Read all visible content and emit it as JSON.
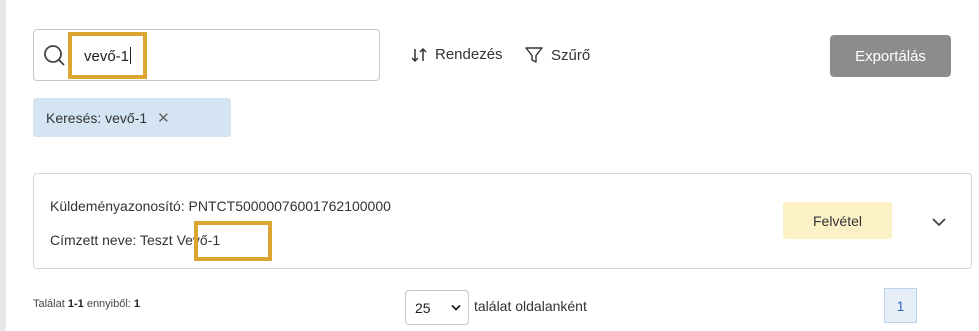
{
  "search": {
    "value": "vevő-1"
  },
  "toolbar": {
    "sort_label": "Rendezés",
    "filter_label": "Szűrő",
    "export_label": "Exportálás"
  },
  "active_filter": {
    "label": "Keresés: vevő-1",
    "close_glyph": "✕"
  },
  "shipment": {
    "id_text": "Küldeményazonosító: PNTCT50000076001762100000",
    "recipient_prefix": "Címzett neve: Teszt ",
    "recipient_name": "Vevő-1",
    "status": "Felvétel"
  },
  "pagination": {
    "summary_prefix": "Találat ",
    "summary_range": "1-1",
    "summary_mid": " ennyiből: ",
    "summary_total": "1",
    "per_page_value": "25",
    "per_page_label": "találat oldalanként",
    "current_page": "1"
  },
  "colors": {
    "highlight": "#dba531",
    "chip_bg": "#d4e4f3",
    "status_bg": "#fcf1c6",
    "export_bg": "#8c8c8c",
    "page_accent": "#2f6db5"
  },
  "icons": [
    "search-icon",
    "sort-icon",
    "filter-icon",
    "close-icon",
    "chevron-down-icon"
  ]
}
